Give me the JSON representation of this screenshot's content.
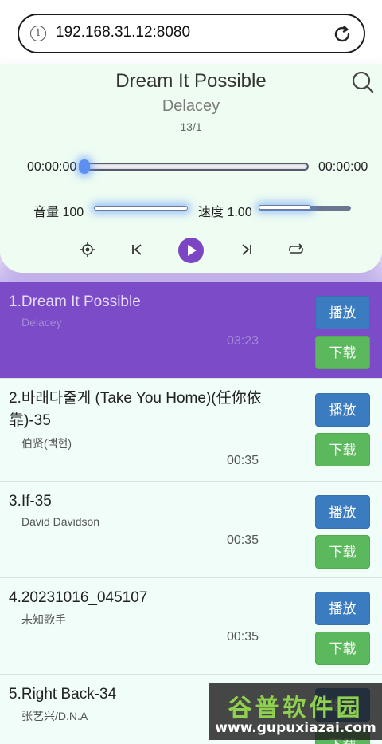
{
  "browser": {
    "url": "192.168.31.12:8080",
    "info_icon": "info-icon",
    "reload_icon": "reload-icon"
  },
  "player": {
    "title": "Dream It Possible",
    "artist": "Delacey",
    "count": "13/1",
    "current_time": "00:00:00",
    "total_time": "00:00:00",
    "progress": 0,
    "volume_label": "音量 100",
    "volume": 100,
    "speed_label": "速度 1.00",
    "speed": 1.0,
    "icons": [
      "locate-icon",
      "previous-icon",
      "play-icon",
      "next-icon",
      "repeat-icon",
      "search-icon"
    ]
  },
  "buttons": {
    "play": "播放",
    "download": "下载"
  },
  "songs": [
    {
      "title": "1.Dream It Possible",
      "artist": "Delacey",
      "duration": "03:23"
    },
    {
      "title": "2.바래다줄게 (Take You Home)(任你依靠)-35",
      "artist": "伯贤(백현)",
      "duration": "00:35"
    },
    {
      "title": "3.If-35",
      "artist": "David Davidson",
      "duration": "00:35"
    },
    {
      "title": "4.20231016_045107",
      "artist": "未知歌手",
      "duration": "00:35"
    },
    {
      "title": "5.Right Back-34",
      "artist": "张艺兴/D.N.A",
      "duration": ""
    }
  ],
  "watermark": {
    "top": "谷普软件园",
    "bottom": "www.gupuxiazai.com"
  },
  "colors": {
    "active_row": "#7c4bc8",
    "row_bg": "#f0fdf9",
    "play_button": "#3b7bbf",
    "download_button": "#5cb85c",
    "accent": "#7b45c3"
  }
}
